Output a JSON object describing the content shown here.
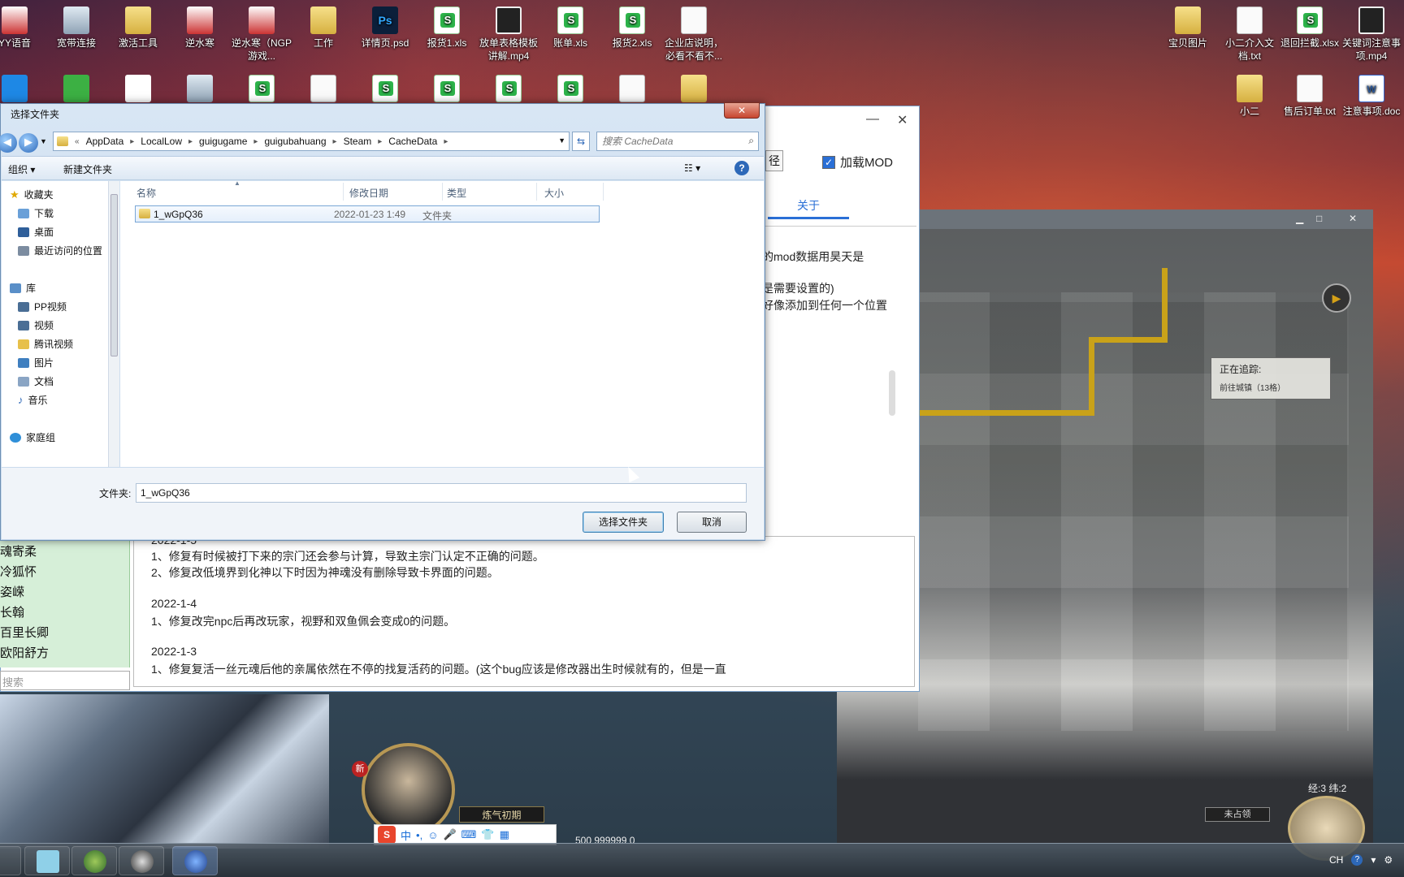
{
  "desktop_icons_row1": [
    {
      "label": "YY语音",
      "icon": "yy-icon"
    },
    {
      "label": "宽带连接",
      "icon": "network-icon"
    },
    {
      "label": "激活工具",
      "icon": "folder-icon"
    },
    {
      "label": "逆水寒",
      "icon": "game-icon"
    },
    {
      "label": "逆水寒（NGP游戏...",
      "icon": "game-icon"
    },
    {
      "label": "工作",
      "icon": "folder-icon"
    },
    {
      "label": "详情页.psd",
      "icon": "psd-icon"
    },
    {
      "label": "报货1.xls",
      "icon": "spreadsheet-icon"
    },
    {
      "label": "放单表格模板讲解.mp4",
      "icon": "video-icon"
    },
    {
      "label": "账单.xls",
      "icon": "spreadsheet-icon"
    },
    {
      "label": "报货2.xls",
      "icon": "spreadsheet-icon"
    },
    {
      "label": "企业店说明，必看不看不...",
      "icon": "document-icon"
    }
  ],
  "desktop_icons_right": [
    {
      "label": "宝贝图片",
      "icon": "folder-icon"
    },
    {
      "label": "小二介入文档.txt",
      "icon": "text-file-icon"
    },
    {
      "label": "退回拦截.xlsx",
      "icon": "spreadsheet-icon"
    },
    {
      "label": "关键词注意事项.mp4",
      "icon": "video-icon"
    },
    {
      "label": "小二",
      "icon": "folder-icon"
    },
    {
      "label": "售后订单.txt",
      "icon": "text-file-icon"
    },
    {
      "label": "注意事项.doc",
      "icon": "word-document-icon"
    }
  ],
  "file_dialog": {
    "title": "选择文件夹",
    "close": "✕",
    "address_prefix": "«",
    "path": [
      "AppData",
      "LocalLow",
      "guigugame",
      "guigubahuang",
      "Steam",
      "CacheData"
    ],
    "search_placeholder": "搜索 CacheData",
    "toolbar": {
      "organize": "组织 ▾",
      "new_folder": "新建文件夹",
      "view": "☷ ▾",
      "help": "?"
    },
    "nav": {
      "favorites": "收藏夹",
      "downloads": "下载",
      "desktop": "桌面",
      "recent": "最近访问的位置",
      "libraries": "库",
      "pp_video": "PP视频",
      "video": "视频",
      "tencent_video": "腾讯视频",
      "pictures": "图片",
      "documents": "文档",
      "music": "音乐",
      "homegroup": "家庭组"
    },
    "columns": {
      "name": "名称",
      "date": "修改日期",
      "type": "类型",
      "size": "大小"
    },
    "files": [
      {
        "name": "1_wGpQ36",
        "date": "2022-01-23 1:49",
        "type": "文件夹"
      }
    ],
    "folder_label": "文件夹:",
    "folder_value": "1_wGpQ36",
    "select_button": "选择文件夹",
    "cancel_button": "取消"
  },
  "mod_window": {
    "path_button_partial": "径",
    "load_mod_label": "加载MOD",
    "tab_about": "关于",
    "text1": "的mod数据用昊天是",
    "text2": "是需要设置的)",
    "text3": "好像添加到任何一个位置",
    "minimize": "—",
    "close": "✕"
  },
  "log": {
    "sidebar": [
      "魂寄柔",
      "冷狐怀",
      "姿嵘",
      "长翰",
      "百里长卿",
      "欧阳舒方"
    ],
    "search_placeholder": "搜索",
    "lines": [
      "2022-1-5",
      "1、修复有时候被打下来的宗门还会参与计算，导致主宗门认定不正确的问题。",
      "2、修复改低境界到化神以下时因为神魂没有删除导致卡界面的问题。",
      "2022-1-4",
      "1、修复改完npc后再改玩家，视野和双鱼佩会变成0的问题。",
      "2022-1-3",
      "1、修复复活一丝元魂后他的亲属依然在不停的找复活药的问题。(这个bug应该是修改器出生时候就有的，但是一直"
    ]
  },
  "game": {
    "tracking_title": "正在追踪:",
    "tracking_item": "前往城镇（13格）",
    "stats": "经:3 纬:2",
    "tag": "未占领",
    "realm": "炼气初期",
    "badge_new": "新",
    "resources": "500   999999   0"
  },
  "ime": {
    "logo": "S",
    "items": [
      "中",
      "•,",
      "☺",
      "🎤",
      "⌨",
      "👕",
      "▦"
    ]
  },
  "tray": {
    "lang": "CH",
    "help": "?"
  }
}
